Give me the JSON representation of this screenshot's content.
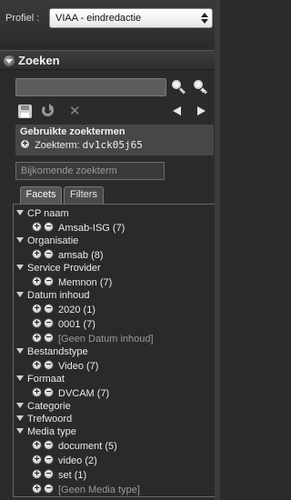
{
  "profile": {
    "label": "Profiel :",
    "value": "VIAA - eindredactie"
  },
  "panel": {
    "title": "Zoeken"
  },
  "search": {
    "value": ""
  },
  "used_terms": {
    "title": "Gebruikte zoektermen",
    "term_label": "Zoekterm:",
    "term_value": "dv1ck05j65"
  },
  "extra_term": {
    "placeholder": "Bijkomende zoekterm"
  },
  "tabs": [
    {
      "label": "Facets",
      "active": true
    },
    {
      "label": "Filters",
      "active": false
    }
  ],
  "facets": [
    {
      "name": "CP naam",
      "items": [
        {
          "label": "Amsab-ISG (7)"
        }
      ]
    },
    {
      "name": "Organisatie",
      "items": [
        {
          "label": "amsab (8)"
        }
      ]
    },
    {
      "name": "Service Provider",
      "items": [
        {
          "label": "Memnon (7)"
        }
      ]
    },
    {
      "name": "Datum inhoud",
      "items": [
        {
          "label": "2020 (1)"
        },
        {
          "label": "0001 (7)"
        },
        {
          "label": "[Geen Datum inhoud]"
        }
      ]
    },
    {
      "name": "Bestandstype",
      "items": [
        {
          "label": "Video (7)"
        }
      ]
    },
    {
      "name": "Formaat",
      "items": [
        {
          "label": "DVCAM (7)"
        }
      ]
    },
    {
      "name": "Categorie",
      "items": []
    },
    {
      "name": "Trefwoord",
      "items": []
    },
    {
      "name": "Media type",
      "items": [
        {
          "label": "document (5)"
        },
        {
          "label": "video (2)"
        },
        {
          "label": "set (1)"
        },
        {
          "label": "[Geen Media type]"
        }
      ]
    }
  ],
  "icons": {
    "search": "magnifier-icon",
    "add_search": "magnifier-plus-icon",
    "save": "floppy-disk-icon",
    "refresh": "refresh-icon",
    "clear": "clear-x-icon",
    "prev": "arrow-left-icon",
    "next": "arrow-right-icon",
    "include": "plus-circle-icon",
    "exclude": "minus-circle-icon",
    "expand": "triangle-down-icon"
  },
  "colors": {
    "background": "#2b2b2b",
    "panel": "#474747",
    "text": "#eaeaea",
    "muted": "#9a9a9a"
  }
}
